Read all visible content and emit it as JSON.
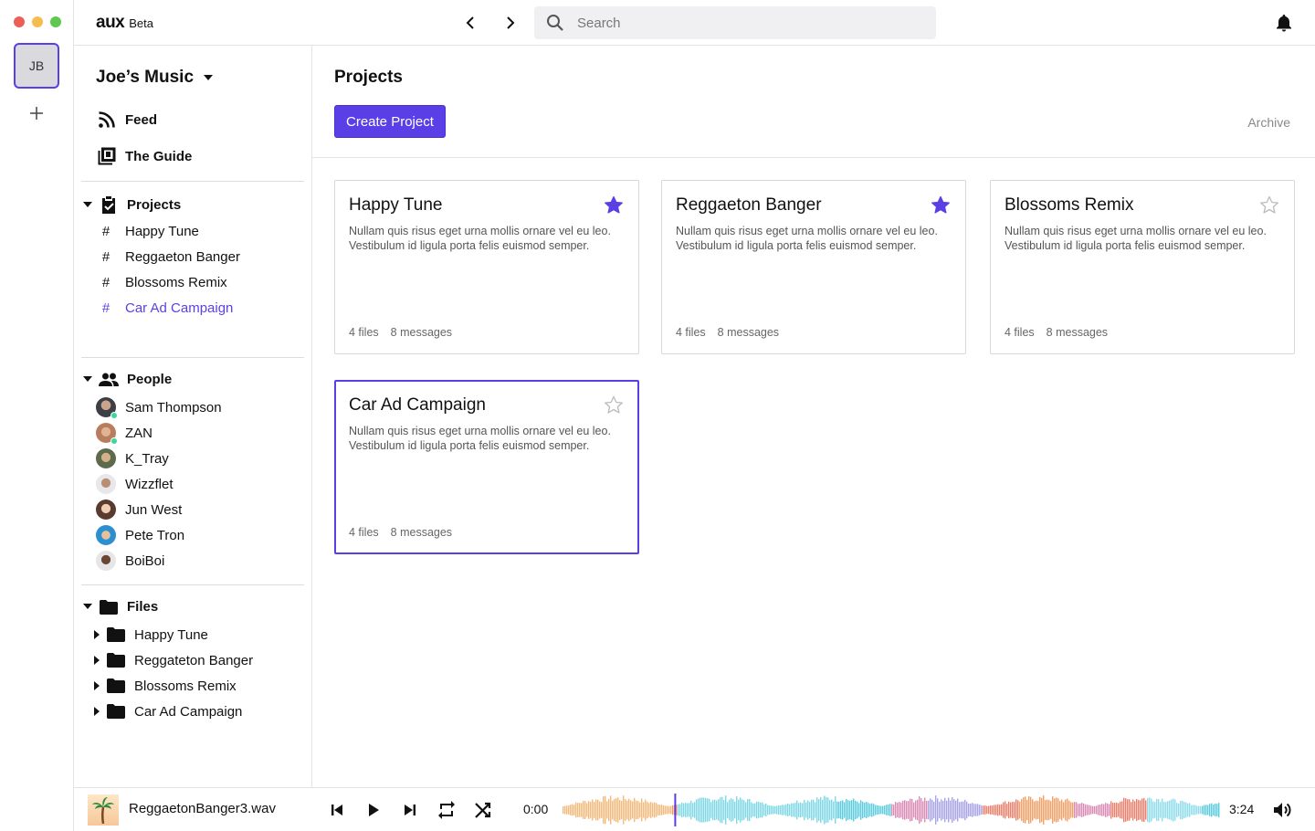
{
  "window": {
    "controls_colors": [
      "#ec5f57",
      "#f5bd4f",
      "#5fc84f"
    ]
  },
  "rail": {
    "workspace_initials": "JB"
  },
  "topbar": {
    "logo_main": "aux",
    "logo_sub": "Beta",
    "search_placeholder": "Search"
  },
  "sidebar": {
    "workspace_name": "Joe’s Music",
    "links": {
      "feed": "Feed",
      "guide": "The Guide"
    },
    "projects": {
      "heading": "Projects",
      "items": [
        "Happy Tune",
        "Reggaeton Banger",
        "Blossoms Remix",
        "Car Ad Campaign"
      ],
      "active_index": 3
    },
    "people": {
      "heading": "People",
      "items": [
        {
          "name": "Sam Thompson",
          "online": true
        },
        {
          "name": "ZAN",
          "online": true
        },
        {
          "name": "K_Tray",
          "online": false
        },
        {
          "name": "Wizzflet",
          "online": false
        },
        {
          "name": "Jun West",
          "online": false
        },
        {
          "name": "Pete Tron",
          "online": false
        },
        {
          "name": "BoiBoi",
          "online": false
        }
      ]
    },
    "files": {
      "heading": "Files",
      "items": [
        "Happy Tune",
        "Reggateton Banger",
        "Blossoms Remix",
        "Car Ad Campaign"
      ]
    }
  },
  "main": {
    "title": "Projects",
    "create_label": "Create Project",
    "archive_label": "Archive",
    "cards": [
      {
        "title": "Happy Tune",
        "desc": "Nullam quis risus eget urna mollis ornare vel eu leo. Vestibulum id ligula porta felis euismod semper.",
        "files": "4 files",
        "messages": "8 messages",
        "starred": true,
        "selected": false
      },
      {
        "title": "Reggaeton Banger",
        "desc": "Nullam quis risus eget urna mollis ornare vel eu leo. Vestibulum id ligula porta felis euismod semper.",
        "files": "4 files",
        "messages": "8 messages",
        "starred": true,
        "selected": false
      },
      {
        "title": "Blossoms Remix",
        "desc": "Nullam quis risus eget urna mollis ornare vel eu leo. Vestibulum id ligula porta felis euismod semper.",
        "files": "4 files",
        "messages": "8 messages",
        "starred": false,
        "selected": false
      },
      {
        "title": "Car Ad Campaign",
        "desc": "Nullam quis risus eget urna mollis ornare vel eu leo. Vestibulum id ligula porta felis euismod semper.",
        "files": "4 files",
        "messages": "8 messages",
        "starred": false,
        "selected": true
      }
    ],
    "accent": "#5b3fe6"
  },
  "player": {
    "track": "ReggaetonBanger3.wav",
    "current_time": "0:00",
    "duration": "3:24",
    "progress": 0.17
  }
}
